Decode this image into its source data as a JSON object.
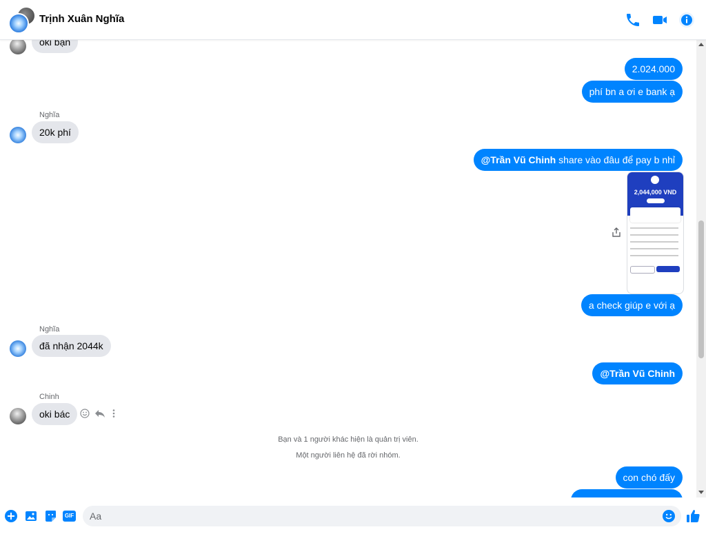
{
  "header": {
    "title": "Trịnh Xuân Nghĩa",
    "icons": [
      "phone-icon",
      "video-call-icon",
      "info-icon"
    ]
  },
  "messages": {
    "m1": "oki bạn",
    "m2": "2.024.000",
    "m3": "phí bn a ơi e bank ạ",
    "sender1": "Nghĩa",
    "m4": "20k phí",
    "m5_mention": "@Trần Vũ Chinh",
    "m5_rest": " share vào đâu để pay b nhỉ",
    "receipt_amount": "2,044,000 VND",
    "m6": "a check giúp e với ạ",
    "sender2": "Nghĩa",
    "m7": "đã nhận 2044k",
    "m8": "@Trần Vũ Chinh",
    "sender3": "Chinh",
    "m9": "oki bác",
    "sys1": "Bạn và 1 người khác hiện là quản trị viên.",
    "sys2": "Một người liên hệ đã rời nhóm.",
    "m10": "con chó đấy"
  },
  "composer": {
    "placeholder": "Aa",
    "gif_label": "GIF",
    "icons": [
      "plus-icon",
      "image-icon",
      "sticker-icon",
      "gif-icon",
      "emoji-icon",
      "like-icon"
    ]
  },
  "colors": {
    "accent": "#0084ff",
    "incoming_bubble": "#e4e6eb"
  }
}
